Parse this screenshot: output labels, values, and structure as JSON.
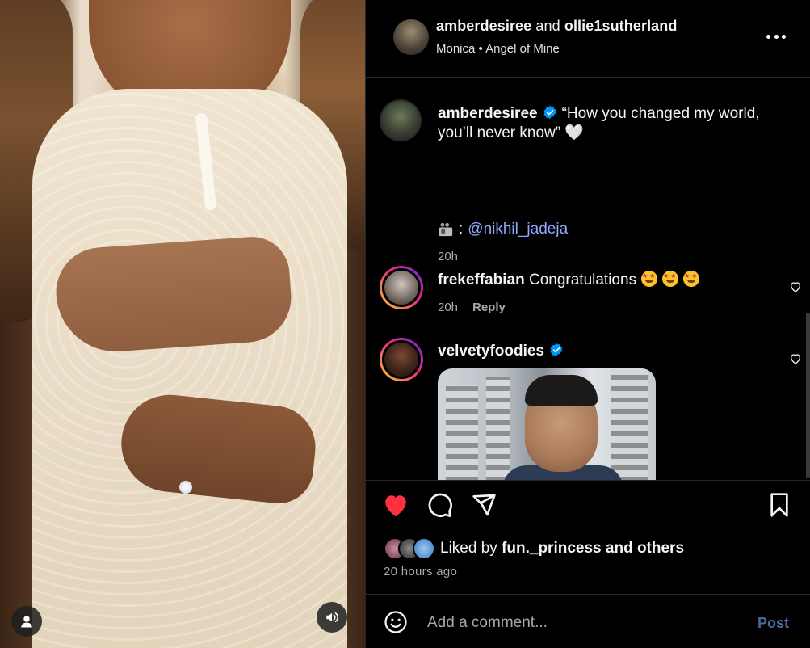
{
  "header": {
    "user1": "amberdesiree",
    "joiner": "and",
    "user2": "ollie1sutherland",
    "audio": "Monica • Angel of Mine"
  },
  "caption": {
    "username": "amberdesiree",
    "text": "“How you changed my world, you’ll never know” 🤍",
    "credit_sep": ":",
    "mention": "@nikhil_jadeja",
    "time": "20h"
  },
  "comments": [
    {
      "username": "frekeffabian",
      "text": "Congratulations",
      "time": "20h",
      "reply": "Reply"
    },
    {
      "username": "velvetyfoodies",
      "verified": true
    }
  ],
  "likes": {
    "prefix": "Liked by",
    "user": "fun._princess",
    "suffix": "and others",
    "ago": "20 hours ago"
  },
  "add_comment": {
    "placeholder": "Add a comment...",
    "post": "Post"
  },
  "colors": {
    "like_active": "#ff3040",
    "mention": "#8fa9ff",
    "verified": "#0095f6"
  },
  "icons": [
    "more-icon",
    "verified-icon",
    "clapper-icon",
    "heart-icon",
    "comment-icon",
    "share-icon",
    "bookmark-icon",
    "emoji-icon",
    "user-icon",
    "speaker-icon"
  ]
}
